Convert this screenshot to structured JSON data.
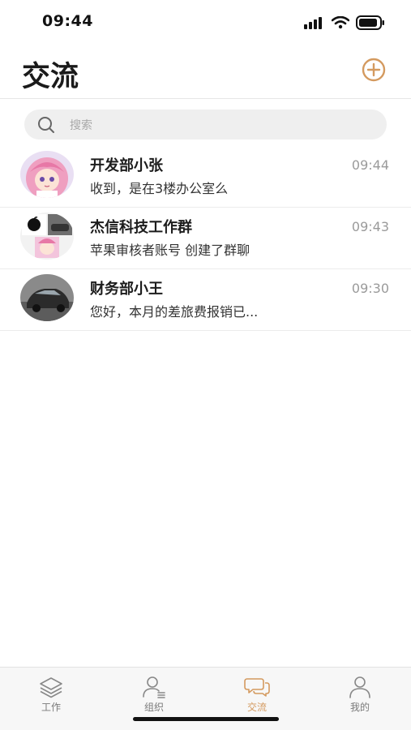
{
  "status_bar": {
    "time": "09:44"
  },
  "header": {
    "title": "交流",
    "add_icon": "plus-circle-icon",
    "accent_color": "#d49a5f"
  },
  "search": {
    "placeholder": "搜索"
  },
  "conversations": [
    {
      "name": "开发部小张",
      "preview": "收到，是在3楼办公室么",
      "time": "09:44",
      "avatar": "anime-girl-avatar"
    },
    {
      "name": "杰信科技工作群",
      "preview": "苹果审核者账号 创建了群聊",
      "time": "09:43",
      "avatar": "group-collage-avatar"
    },
    {
      "name": "财务部小王",
      "preview": "您好，本月的差旅费报销已...",
      "time": "09:30",
      "avatar": "car-photo-avatar"
    }
  ],
  "tabs": [
    {
      "label": "工作",
      "icon": "layers-icon"
    },
    {
      "label": "组织",
      "icon": "contacts-icon"
    },
    {
      "label": "交流",
      "icon": "chat-bubbles-icon",
      "active": true
    },
    {
      "label": "我的",
      "icon": "person-icon"
    }
  ]
}
